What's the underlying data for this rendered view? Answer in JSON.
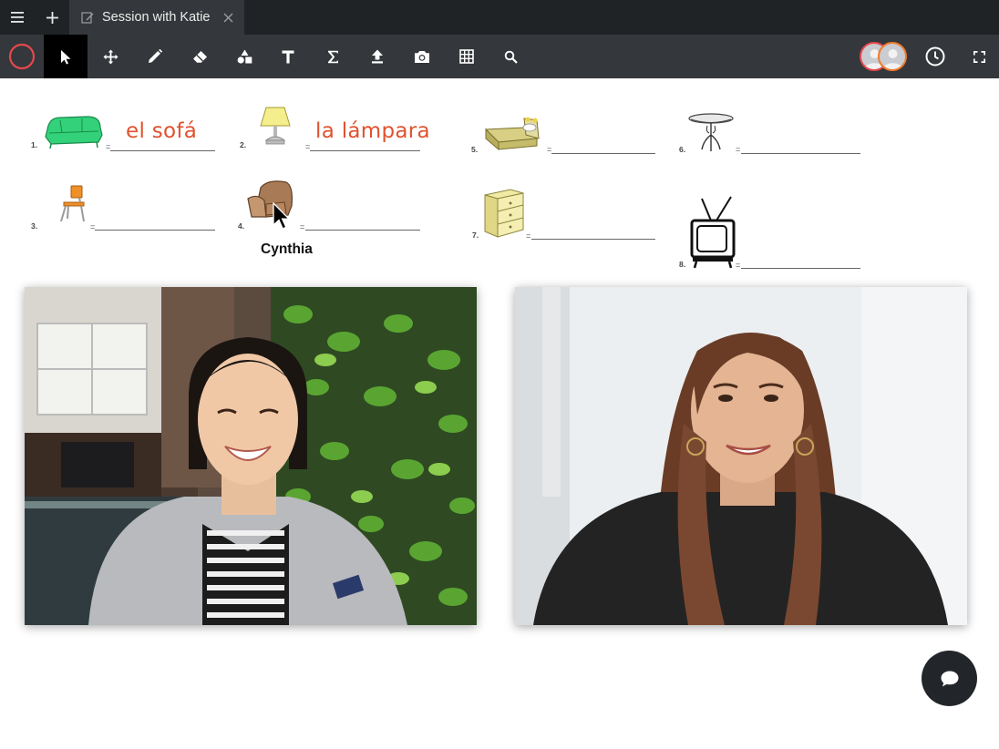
{
  "tabbar": {
    "menu_icon": "hamburger-menu-icon",
    "new_tab_icon": "plus-icon",
    "tab": {
      "title": "Session with Katie",
      "icon": "edit-icon",
      "close_icon": "close-icon"
    }
  },
  "toolbar": {
    "tools": [
      {
        "name": "record",
        "icon": "record-icon",
        "active": false
      },
      {
        "name": "select",
        "icon": "cursor-arrow-icon",
        "active": true
      },
      {
        "name": "move",
        "icon": "move-icon",
        "active": false
      },
      {
        "name": "pen",
        "icon": "pencil-icon",
        "active": false
      },
      {
        "name": "eraser",
        "icon": "eraser-icon",
        "active": false
      },
      {
        "name": "shapes",
        "icon": "shapes-icon",
        "active": false
      },
      {
        "name": "text",
        "icon": "text-icon",
        "active": false
      },
      {
        "name": "equation",
        "icon": "sigma-icon",
        "active": false
      },
      {
        "name": "upload",
        "icon": "upload-icon",
        "active": false
      },
      {
        "name": "camera",
        "icon": "camera-icon",
        "active": false
      },
      {
        "name": "table",
        "icon": "grid-icon",
        "active": false
      },
      {
        "name": "search",
        "icon": "search-icon",
        "active": false
      }
    ],
    "right": {
      "participants_icon": "participants-avatars-icon",
      "history_icon": "clock-icon",
      "fullscreen_icon": "fullscreen-icon"
    },
    "colors": {
      "record_ring": "#e5484d",
      "avatar_ring_1": "#e5484d",
      "avatar_ring_2": "#f07b2a"
    }
  },
  "worksheet": {
    "items": [
      {
        "number": "1.",
        "object": "sofa",
        "answer": "el sofá"
      },
      {
        "number": "2.",
        "object": "lamp",
        "answer": "la lámpara"
      },
      {
        "number": "3.",
        "object": "chair",
        "answer": ""
      },
      {
        "number": "4.",
        "object": "armchair",
        "answer": ""
      },
      {
        "number": "5.",
        "object": "bed",
        "answer": ""
      },
      {
        "number": "6.",
        "object": "table",
        "answer": ""
      },
      {
        "number": "7.",
        "object": "dresser",
        "answer": ""
      },
      {
        "number": "8.",
        "object": "television",
        "answer": ""
      }
    ],
    "equals_sign": "=",
    "cursor_label": "Cynthia",
    "answer_color": "#e0522e"
  },
  "videos": [
    {
      "name": "participant-video-left",
      "description_icon": "video-feed"
    },
    {
      "name": "participant-video-right",
      "description_icon": "video-feed"
    }
  ],
  "chat": {
    "icon": "chat-bubble-icon"
  }
}
